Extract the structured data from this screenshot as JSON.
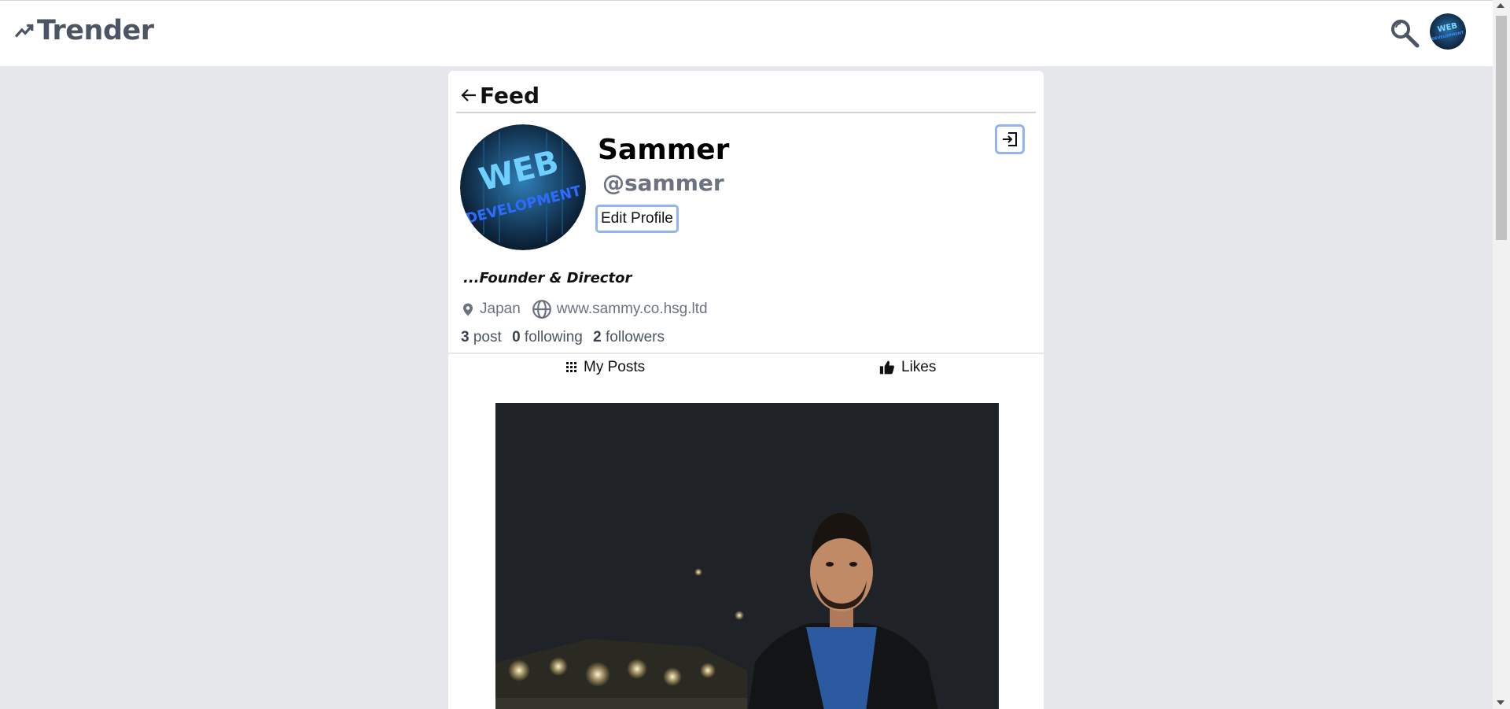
{
  "app": {
    "brand": "Trender"
  },
  "feed": {
    "title": "Feed"
  },
  "profile": {
    "name": "Sammer",
    "handle": "@sammer",
    "edit_label": "Edit Profile",
    "bio": "...Founder & Director",
    "location": "Japan",
    "website": "www.sammy.co.hsg.ltd",
    "stats": {
      "posts": "3",
      "posts_label": "post",
      "following": "0",
      "following_label": "following",
      "followers": "2",
      "followers_label": "followers"
    },
    "avatar_text": {
      "line1": "WEB",
      "line2": "DEVELOPMENT"
    }
  },
  "tabs": [
    {
      "label": "My Posts",
      "icon": "grid-icon"
    },
    {
      "label": "Likes",
      "icon": "thumbs-up-icon"
    }
  ],
  "colors": {
    "accent_outline": "#93b4f0",
    "muted": "#6b7280",
    "page_bg": "#e5e7eb"
  }
}
